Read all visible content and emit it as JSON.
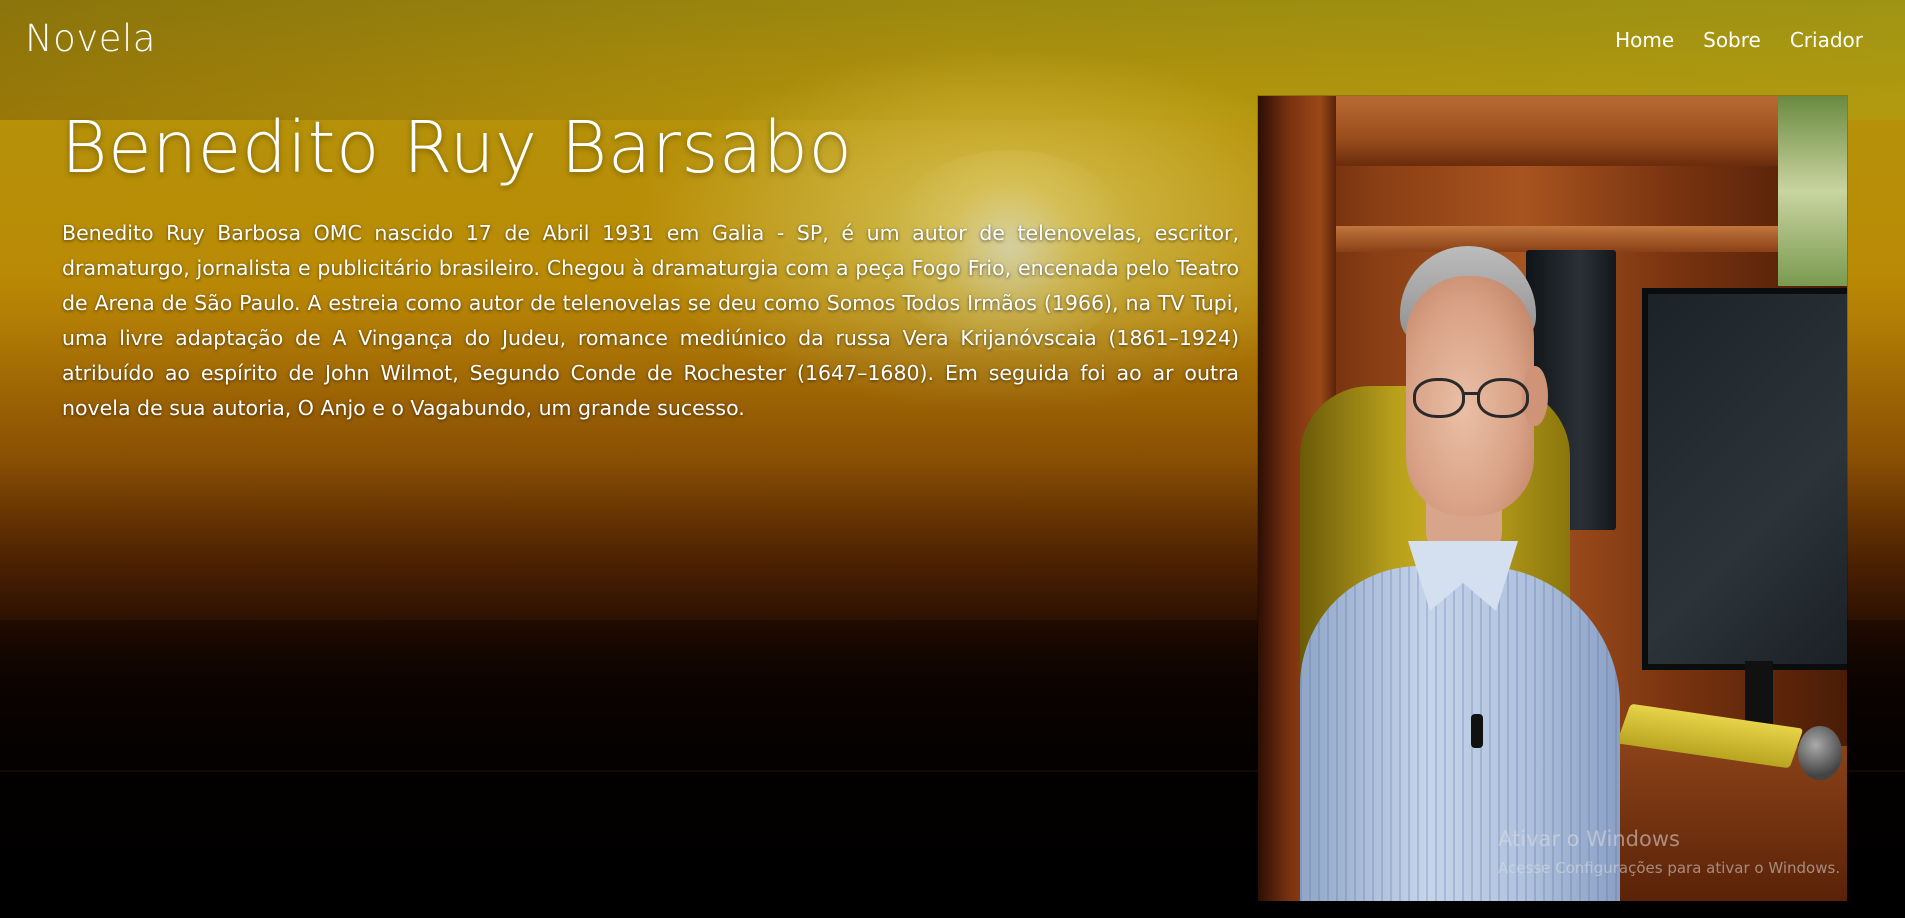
{
  "header": {
    "brand": "Novela",
    "nav": [
      {
        "label": "Home"
      },
      {
        "label": "Sobre"
      },
      {
        "label": "Criador"
      }
    ]
  },
  "main": {
    "title": "Benedito Ruy Barsabo",
    "bio": "Benedito Ruy Barbosa OMC nascido 17 de Abril 1931 em Galia - SP, é um autor de telenovelas, escritor, dramaturgo, jornalista e publicitário brasileiro. Chegou à dramaturgia com a peça Fogo Frio, encenada pelo Teatro de Arena de São Paulo. A estreia como autor de telenovelas se deu como Somos Todos Irmãos (1966), na TV Tupi, uma livre adaptação de A Vingança do Judeu, romance mediúnico da russa Vera Krijanóvscaia (1861–1924) atribuído ao espírito de John Wilmot, Segundo Conde de Rochester (1647–1680). Em seguida foi ao ar outra novela de sua autoria, O Anjo e o Vagabundo, um grande sucesso."
  },
  "watermark": {
    "title": "Ativar o Windows",
    "subtitle": "Acesse Configurações para ativar o Windows."
  },
  "colors": {
    "text": "#ffffff",
    "sky_top": "#9a8a10",
    "sunset": "#e2a806",
    "ground": "#050201"
  }
}
